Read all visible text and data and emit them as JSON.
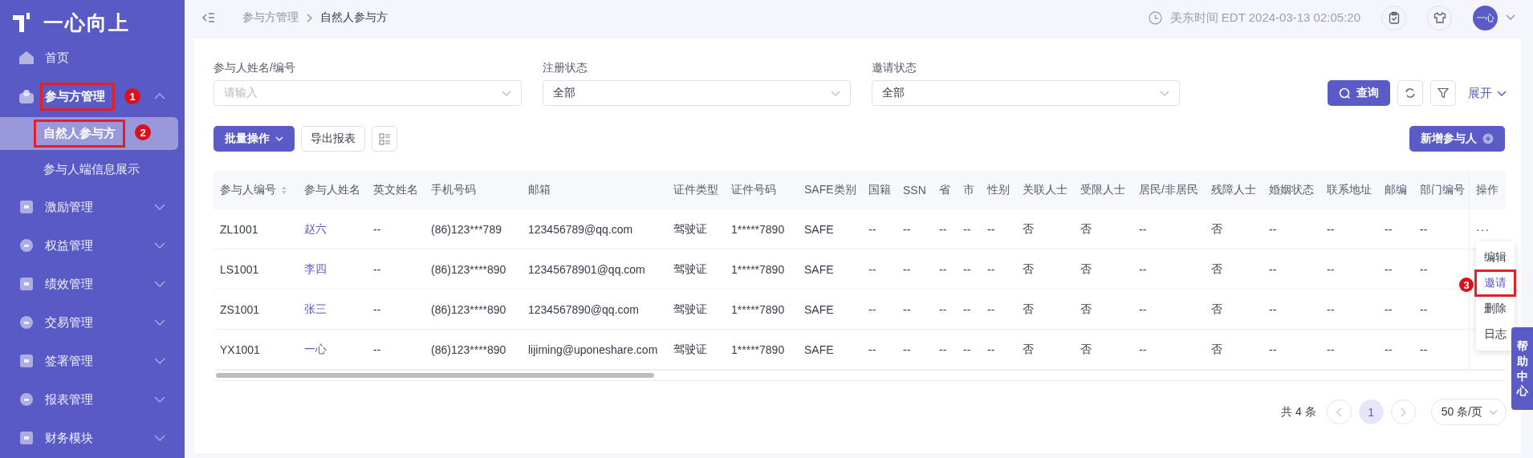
{
  "sidebar": {
    "logo": "一心向上",
    "items": [
      {
        "kind": "link",
        "label": "首页",
        "selected": false
      },
      {
        "kind": "group",
        "label": "参与方管理",
        "expanded": true,
        "marker": "1",
        "children": [
          {
            "label": "自然人参与方",
            "selected": true,
            "marker": "2"
          },
          {
            "label": "参与人端信息展示",
            "selected": false
          }
        ]
      },
      {
        "kind": "group",
        "label": "激励管理",
        "expanded": false
      },
      {
        "kind": "group",
        "label": "权益管理",
        "expanded": false
      },
      {
        "kind": "group",
        "label": "绩效管理",
        "expanded": false
      },
      {
        "kind": "group",
        "label": "交易管理",
        "expanded": false
      },
      {
        "kind": "group",
        "label": "签署管理",
        "expanded": false
      },
      {
        "kind": "group",
        "label": "报表管理",
        "expanded": false
      },
      {
        "kind": "group",
        "label": "财务模块",
        "expanded": false
      }
    ]
  },
  "topbar": {
    "breadcrumbs": [
      "参与方管理",
      "自然人参与方"
    ],
    "time": "美东时间 EDT 2024-03-13 02:05:20",
    "avatar": "一心"
  },
  "filters": [
    {
      "label": "参与人姓名/编号",
      "placeholder": "请输入"
    },
    {
      "label": "注册状态",
      "value": "全部"
    },
    {
      "label": "邀请状态",
      "value": "全部"
    }
  ],
  "filter_buttons": {
    "search": "查询",
    "expand": "展开"
  },
  "toolbar": {
    "batch": "批量操作",
    "export": "导出报表",
    "add": "新增参与人"
  },
  "table": {
    "columns": [
      "参与人编号",
      "参与人姓名",
      "英文姓名",
      "手机号码",
      "邮箱",
      "证件类型",
      "证件号码",
      "SAFE类别",
      "国籍",
      "SSN",
      "省",
      "市",
      "性别",
      "关联人士",
      "受限人士",
      "居民/非居民",
      "残障人士",
      "婚姻状态",
      "联系地址",
      "邮编",
      "部门编号"
    ],
    "actions_column": "操作",
    "rows": [
      {
        "cells": [
          "ZL1001",
          "赵六",
          "--",
          "(86)123***789",
          "123456789@qq.com",
          "驾驶证",
          "1*****7890",
          "SAFE",
          "--",
          "--",
          "--",
          "--",
          "--",
          "否",
          "否",
          "--",
          "否",
          "--",
          "--",
          "--",
          "--"
        ],
        "actions": "···"
      },
      {
        "cells": [
          "LS1001",
          "李四",
          "--",
          "(86)123****890",
          "12345678901@qq.com",
          "驾驶证",
          "1*****7890",
          "SAFE",
          "--",
          "--",
          "--",
          "--",
          "--",
          "否",
          "否",
          "--",
          "否",
          "--",
          "--",
          "--",
          "--"
        ]
      },
      {
        "cells": [
          "ZS1001",
          "张三",
          "--",
          "(86)123****890",
          "1234567890@qq.com",
          "驾驶证",
          "1*****7890",
          "SAFE",
          "--",
          "--",
          "--",
          "--",
          "--",
          "否",
          "否",
          "--",
          "否",
          "--",
          "--",
          "--",
          "--"
        ]
      },
      {
        "cells": [
          "YX1001",
          "一心",
          "--",
          "(86)123****890",
          "lijiming@uponeshare.com",
          "驾驶证",
          "1*****7890",
          "SAFE",
          "--",
          "--",
          "--",
          "--",
          "--",
          "否",
          "否",
          "--",
          "否",
          "--",
          "--",
          "--",
          "--"
        ]
      }
    ]
  },
  "row_menu": {
    "marker": "3",
    "items": [
      {
        "label": "编辑",
        "selected": false
      },
      {
        "label": "邀请",
        "selected": true
      },
      {
        "label": "删除",
        "selected": false
      },
      {
        "label": "日志",
        "selected": false
      }
    ]
  },
  "pagination": {
    "total": "共 4 条",
    "pages": [
      {
        "label": "1",
        "selected": true
      }
    ],
    "page_size": "50 条/页"
  },
  "help": "帮助中心"
}
